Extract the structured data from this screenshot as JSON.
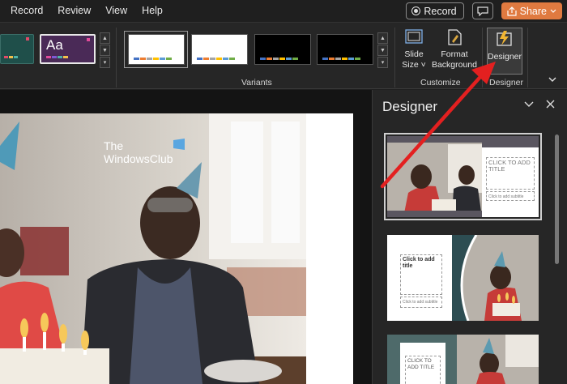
{
  "menu": {
    "items": [
      "Record",
      "Review",
      "View",
      "Help"
    ],
    "record_button": "Record",
    "share_button": "Share"
  },
  "ribbon": {
    "theme_sample_text": "Aa",
    "groups": {
      "variants": "Variants",
      "customize": "Customize",
      "designer": "Designer"
    },
    "buttons": {
      "slide_size_line1": "Slide",
      "slide_size_line2": "Size",
      "format_bg_line1": "Format",
      "format_bg_line2": "Background",
      "designer": "Designer"
    },
    "variant_palette": [
      "#4472c4",
      "#ed7d31",
      "#a5a5a5",
      "#ffc000",
      "#5b9bd5",
      "#70ad47"
    ]
  },
  "slide": {
    "watermark_line1": "The",
    "watermark_line2": "WindowsClub"
  },
  "designer_pane": {
    "title": "Designer",
    "cards": [
      {
        "title_placeholder": "CLICK TO ADD TITLE",
        "subtitle_placeholder": "Click to add subtitle"
      },
      {
        "title_placeholder": "Click to add title",
        "subtitle_placeholder": "Click to add subtitle"
      },
      {
        "title_placeholder": "CLICK TO ADD TITLE",
        "subtitle_placeholder": ""
      }
    ]
  },
  "colors": {
    "accent_orange": "#e07a40",
    "annotation_red": "#e32020"
  }
}
